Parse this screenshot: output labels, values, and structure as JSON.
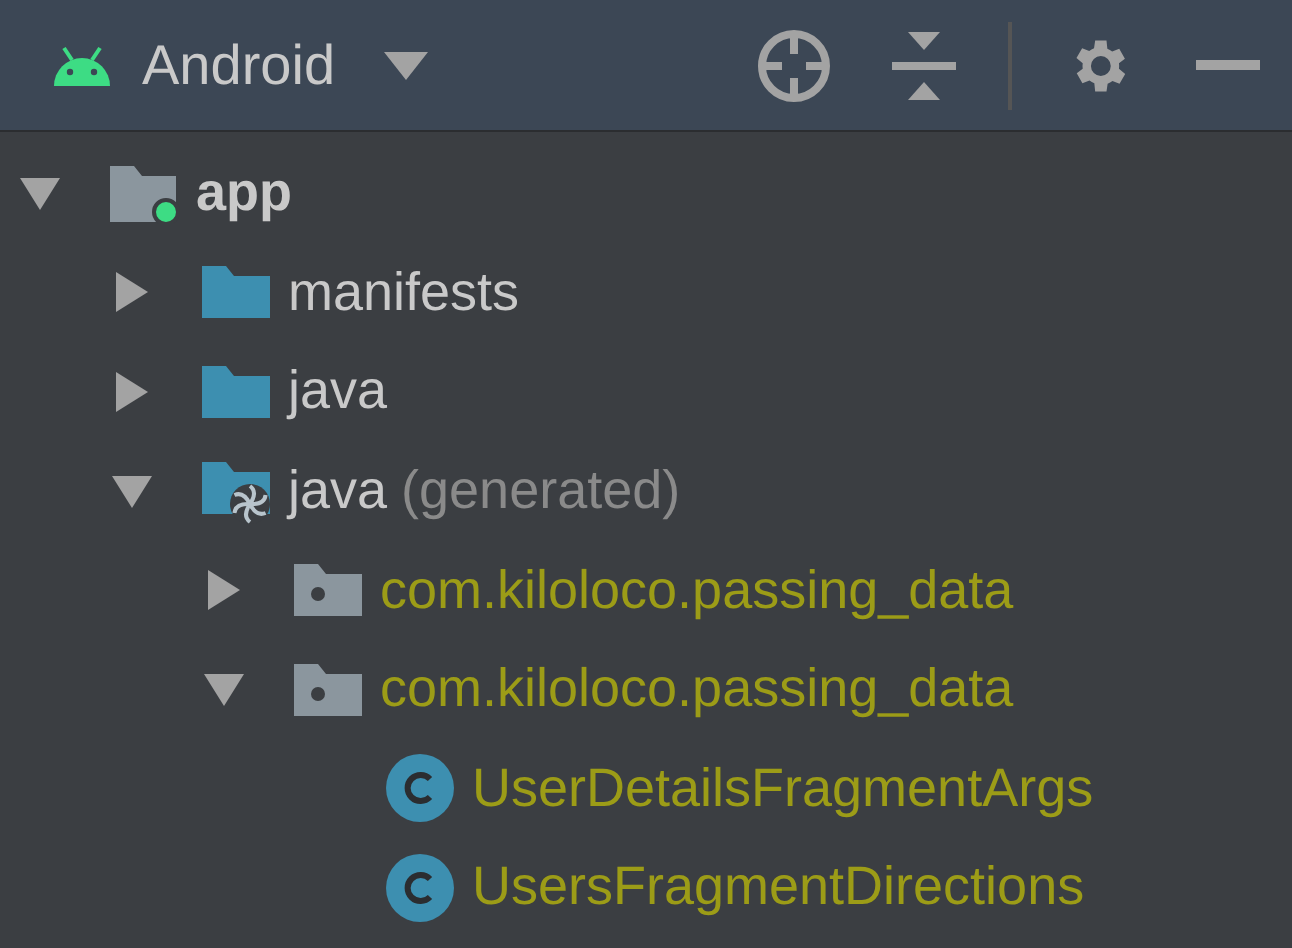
{
  "toolbar": {
    "view": "Android"
  },
  "tree": [
    {
      "label": "app",
      "kind": "module",
      "expanded": true,
      "children": [
        {
          "label": "manifests",
          "kind": "folder",
          "expanded": false
        },
        {
          "label": "java",
          "kind": "folder",
          "expanded": false
        },
        {
          "label": "java",
          "note": "(generated)",
          "kind": "generated",
          "expanded": true,
          "children": [
            {
              "label": "com.kiloloco.passing_data",
              "kind": "package",
              "expanded": false
            },
            {
              "label": "com.kiloloco.passing_data",
              "kind": "package",
              "expanded": true,
              "children": [
                {
                  "label": "UserDetailsFragmentArgs",
                  "kind": "class"
                },
                {
                  "label": "UsersFragmentDirections",
                  "kind": "class"
                }
              ]
            }
          ]
        }
      ]
    }
  ]
}
